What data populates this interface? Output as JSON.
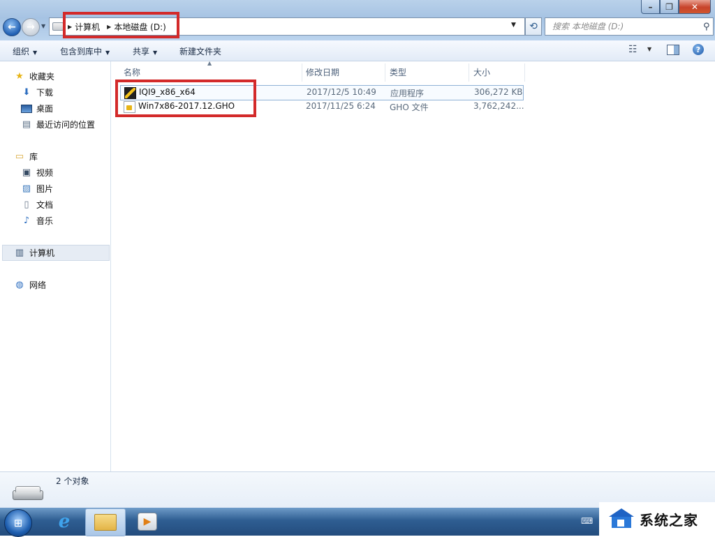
{
  "window": {
    "minimize_glyph": "–",
    "maximize_glyph": "❐",
    "close_glyph": "✕"
  },
  "address_bar": {
    "crumbs": [
      "计算机",
      "本地磁盘 (D:)"
    ],
    "search_placeholder": "搜索 本地磁盘 (D:)"
  },
  "toolbar": {
    "organize": "组织",
    "include_in_library": "包含到库中",
    "share": "共享",
    "new_folder": "新建文件夹"
  },
  "nav": {
    "favorites": "收藏夹",
    "downloads": "下载",
    "desktop": "桌面",
    "recent": "最近访问的位置",
    "libraries": "库",
    "videos": "视频",
    "pictures": "图片",
    "documents": "文档",
    "music": "音乐",
    "computer": "计算机",
    "network": "网络"
  },
  "columns": {
    "name": "名称",
    "modified": "修改日期",
    "type": "类型",
    "size": "大小"
  },
  "files": [
    {
      "name": "IQI9_x86_x64",
      "modified": "2017/12/5 10:49",
      "type": "应用程序",
      "size": "306,272 KB",
      "icon": "app-icon"
    },
    {
      "name": "Win7x86-2017.12.GHO",
      "modified": "2017/11/25 6:24",
      "type": "GHO 文件",
      "size": "3,762,242...",
      "icon": "gho-file-icon"
    }
  ],
  "details": {
    "count": "2 个对象"
  },
  "watermark": {
    "text": "系统之家"
  },
  "colors": {
    "highlight": "#d32a2a",
    "titlebar": "#b9d1ea",
    "taskbar": "#2f5e92"
  }
}
